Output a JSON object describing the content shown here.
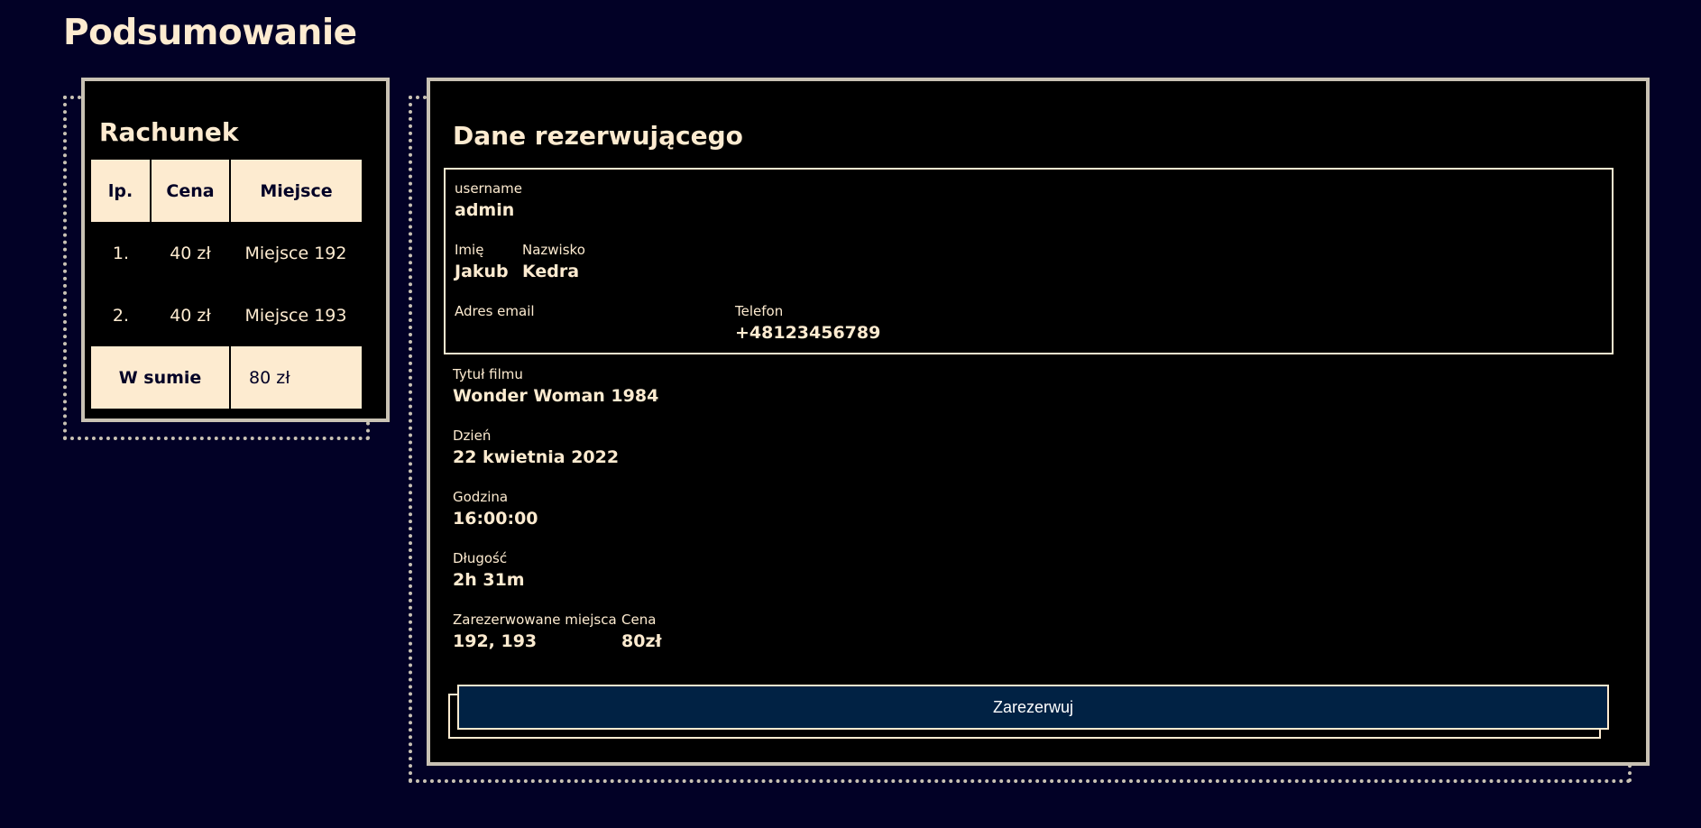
{
  "page": {
    "title": "Podsumowanie"
  },
  "bill": {
    "title": "Rachunek",
    "headers": [
      "lp.",
      "Cena",
      "Miejsce"
    ],
    "rows": [
      {
        "lp": "1.",
        "price": "40 zł",
        "seat": "Miejsce 192"
      },
      {
        "lp": "2.",
        "price": "40 zł",
        "seat": "Miejsce 193"
      }
    ],
    "total_label": "W sumie",
    "total_value": "80 zł"
  },
  "details": {
    "title": "Dane rezerwującego",
    "user": {
      "username_label": "username",
      "username_value": "admin",
      "first_name_label": "Imię",
      "first_name_value": "Jakub",
      "last_name_label": "Nazwisko",
      "last_name_value": "Kedra",
      "email_label": "Adres email",
      "email_value": "",
      "phone_label": "Telefon",
      "phone_value": "+48123456789"
    },
    "movie_label": "Tytuł filmu",
    "movie_value": "Wonder Woman 1984",
    "day_label": "Dzień",
    "day_value": "22 kwietnia 2022",
    "time_label": "Godzina",
    "time_value": "16:00:00",
    "duration_label": "Długość",
    "duration_value": "2h 31m",
    "seats_label": "Zarezerwowane miejsca",
    "seats_value": "192, 193",
    "price_label": "Cena",
    "price_value": "80zł"
  },
  "actions": {
    "reserve_label": "Zarezerwuj"
  },
  "colors": {
    "background": "#020126",
    "card": "#000000",
    "cream": "#fdebd0",
    "border": "#c9c2b4",
    "button": "#012244"
  }
}
